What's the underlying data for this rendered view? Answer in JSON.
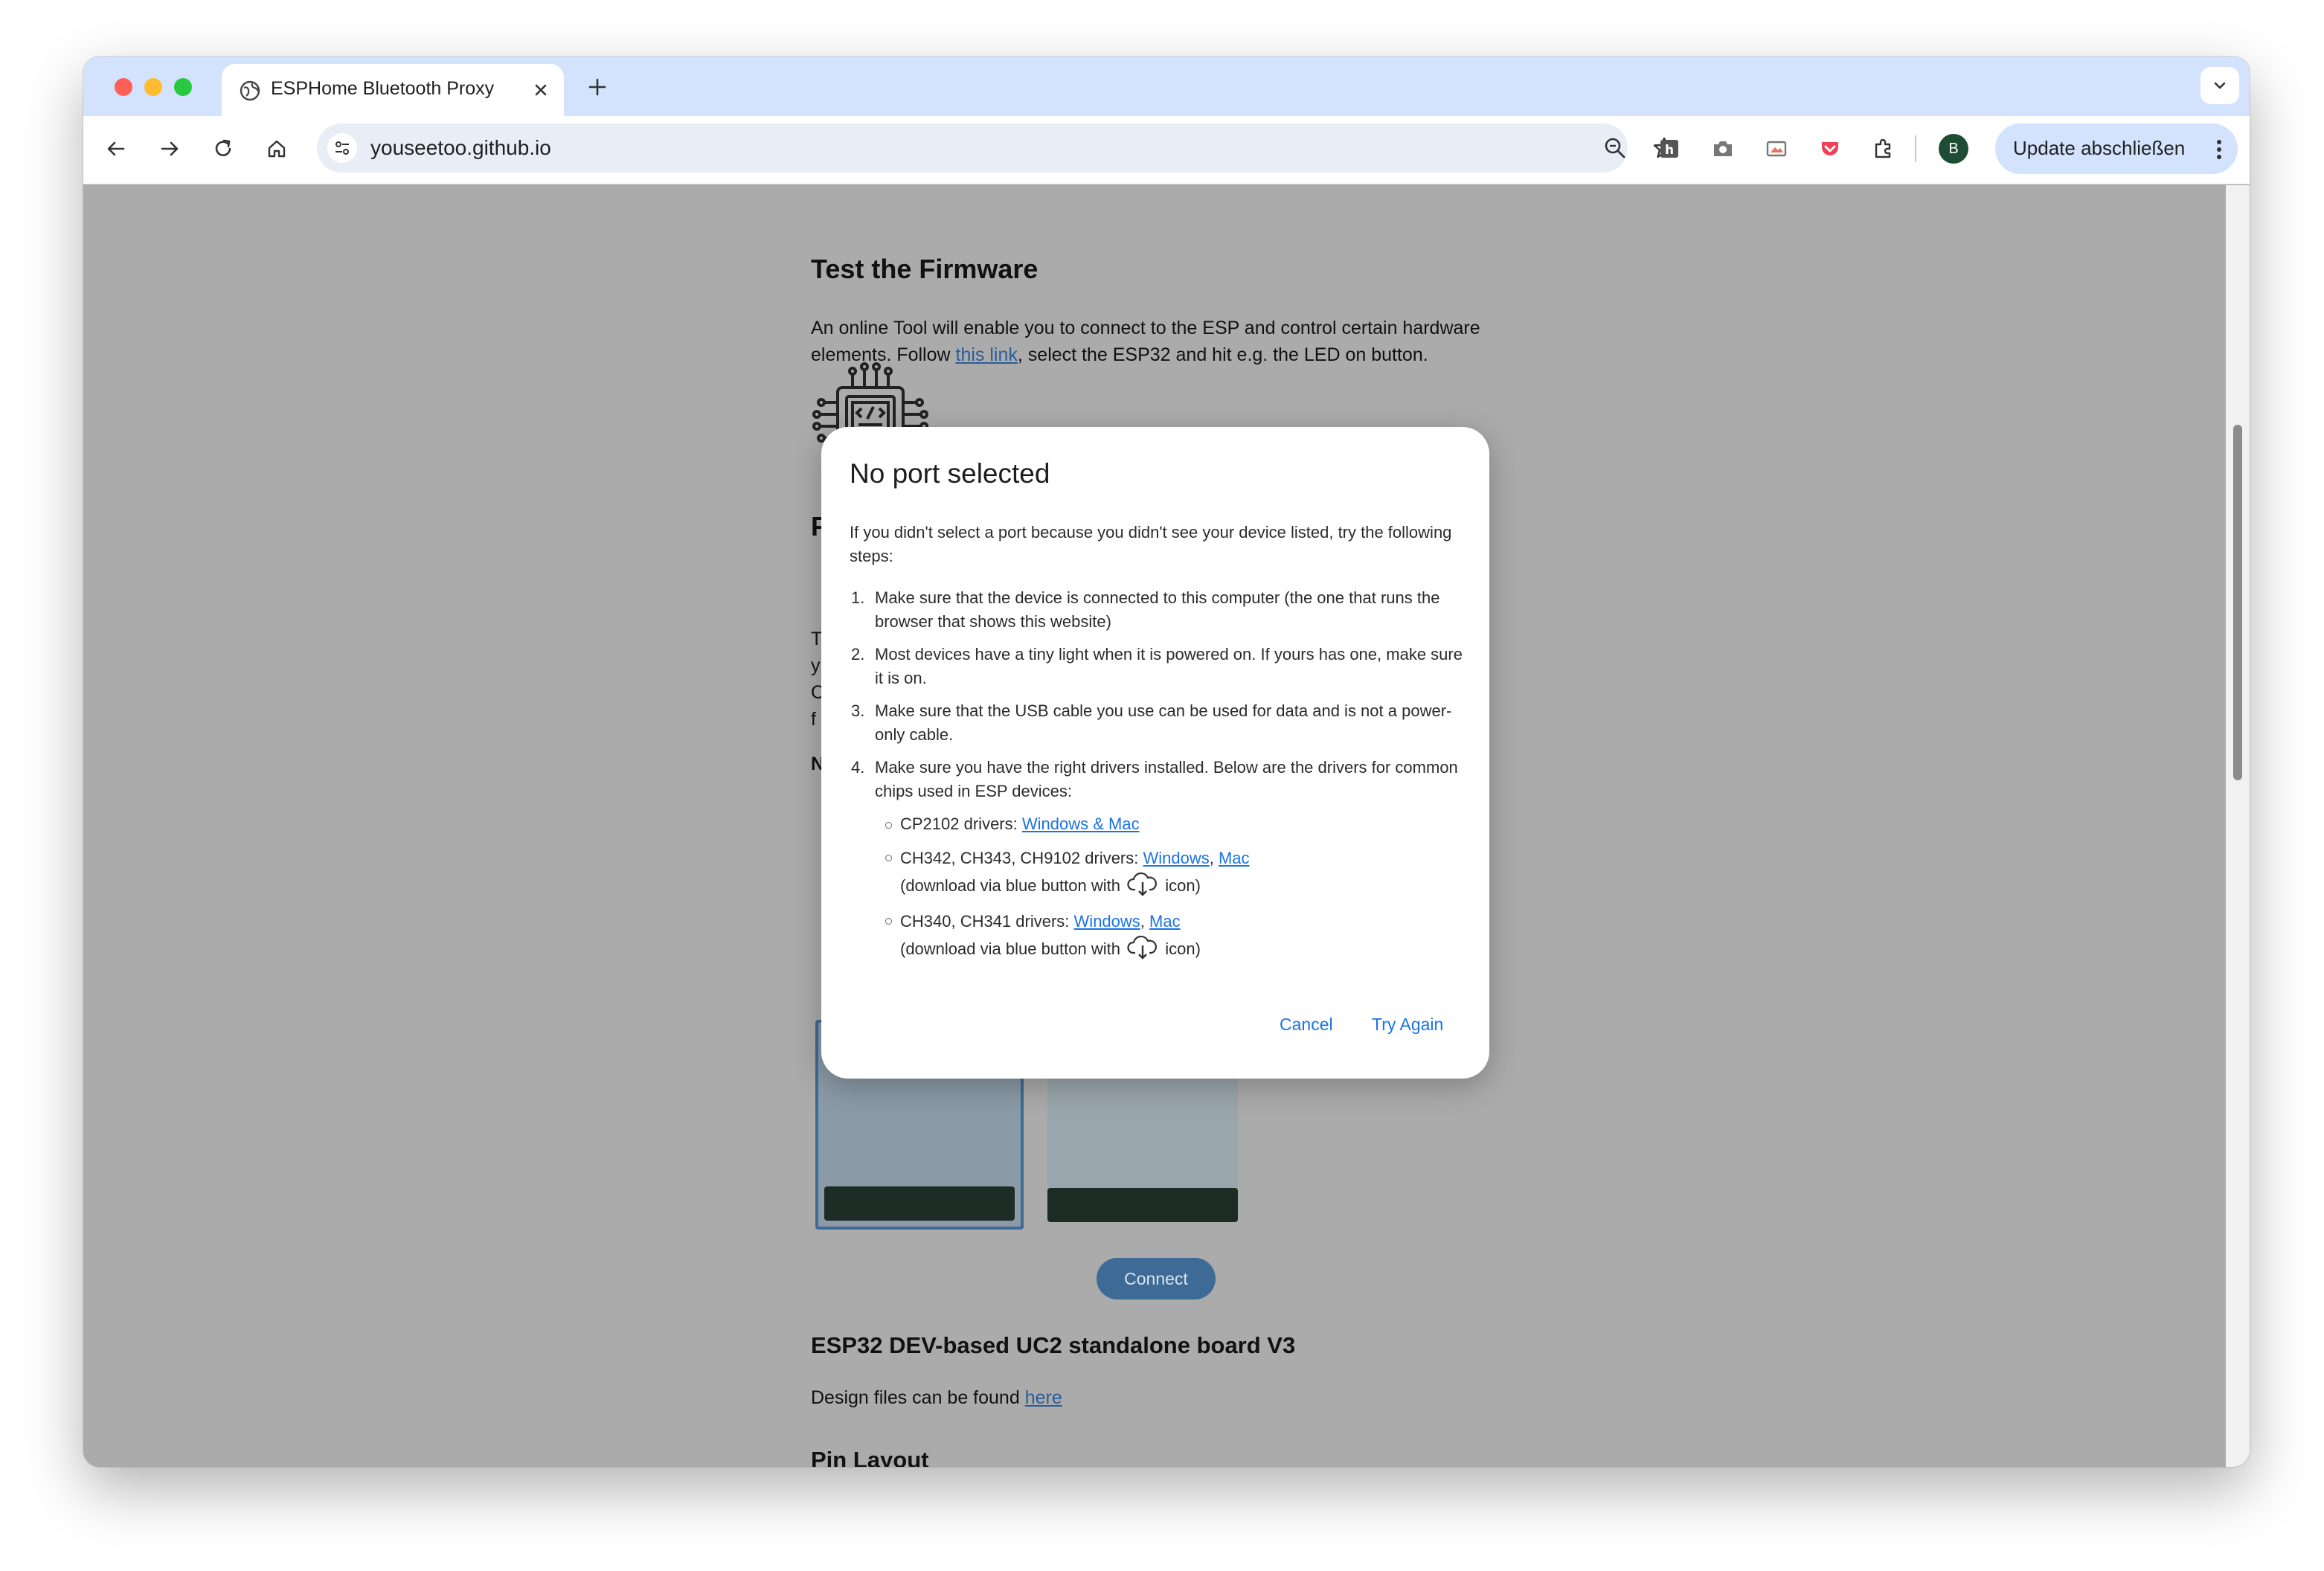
{
  "browser": {
    "tab_title": "ESPHome Bluetooth Proxy",
    "url": "youseetoo.github.io",
    "profile_initial": "B",
    "update_label": "Update abschließen"
  },
  "page": {
    "test_heading": "Test the Firmware",
    "test_text_1": "An online Tool will enable you to connect to the ESP and control certain hardware elements. Follow ",
    "test_link": "this link",
    "test_text_2": ", select the ESP32 and hit e.g. the LED on button.",
    "peek_letters": [
      "F",
      "T",
      "y",
      "C",
      "f",
      "N"
    ],
    "connect_label": "Connect",
    "board_heading": "ESP32 DEV-based UC2 standalone board V3",
    "design_text": "Design files can be found ",
    "design_link": "here",
    "pin_heading": "Pin Layout"
  },
  "dialog": {
    "title": "No port selected",
    "intro": "If you didn't select a port because you didn't see your device listed, try the following steps:",
    "steps": [
      {
        "num": "1.",
        "text": "Make sure that the device is connected to this computer (the one that runs the browser that shows this website)"
      },
      {
        "num": "2.",
        "text": "Most devices have a tiny light when it is powered on. If yours has one, make sure it is on."
      },
      {
        "num": "3.",
        "text": "Make sure that the USB cable you use can be used for data and is not a power-only cable."
      },
      {
        "num": "4.",
        "text": "Make sure you have the right drivers installed. Below are the drivers for common chips used in ESP devices:"
      }
    ],
    "drivers": {
      "cp2102_label": "CP2102 drivers: ",
      "cp2102_link": "Windows & Mac",
      "ch342_label": "CH342, CH343, CH9102 drivers: ",
      "ch342_link_win": "Windows",
      "ch342_link_mac": "Mac",
      "ch340_label": "CH340, CH341 drivers: ",
      "ch340_link_win": "Windows",
      "ch340_link_mac": "Mac",
      "comma": ", ",
      "download_pre": "(download via blue button with ",
      "download_post": " icon)"
    },
    "cancel_label": "Cancel",
    "retry_label": "Try Again"
  },
  "colors": {
    "overlay_page": "#ababab",
    "dialog_link": "#1a73e8",
    "tabstrip": "#d3e3fd"
  }
}
